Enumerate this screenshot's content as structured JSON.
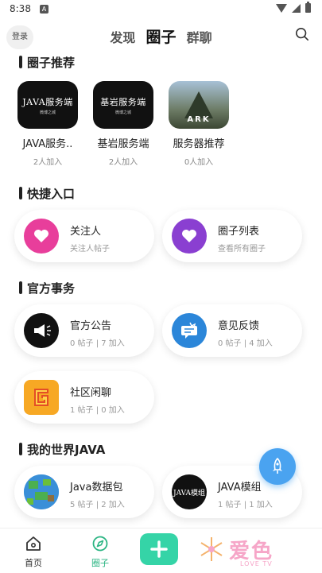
{
  "status": {
    "time": "8:38",
    "notif_letter": "A"
  },
  "header": {
    "login": "登录",
    "tabs": [
      "发现",
      "圈子",
      "群聊"
    ]
  },
  "recommend": {
    "title": "圈子推荐",
    "items": [
      {
        "thumb_text": "JAVA服务端",
        "thumb_sub": "微博之城",
        "name": "JAVA服务..",
        "count": "2人加入"
      },
      {
        "thumb_text": "基岩服务端",
        "thumb_sub": "微博之城",
        "name": "基岩服务端",
        "count": "2人加入"
      },
      {
        "thumb_text": "ARK",
        "name": "服务器推荐",
        "count": "0人加入"
      }
    ]
  },
  "quick": {
    "title": "快捷入口",
    "items": [
      {
        "title": "关注人",
        "sub": "关注人帖子",
        "color": "#e83e9b"
      },
      {
        "title": "圈子列表",
        "sub": "查看所有圈子",
        "color": "#8a3fd1"
      }
    ]
  },
  "official": {
    "title": "官方事务",
    "items": [
      {
        "title": "官方公告",
        "sub": "0 帖子 | 7 加入"
      },
      {
        "title": "意见反馈",
        "sub": "0 帖子 | 4 加入"
      },
      {
        "title": "社区闲聊",
        "sub": "1 帖子 | 0 加入"
      }
    ]
  },
  "mc_java": {
    "title": "我的世界JAVA",
    "items": [
      {
        "title": "Java数据包",
        "sub": "5 帖子 | 2 加入"
      },
      {
        "title": "JAVA模组",
        "sub": "1 帖子 | 1 加入",
        "thumb_text": "JAVA模组"
      }
    ]
  },
  "nav": {
    "home": "首页",
    "circle": "圈子",
    "watermark": "爱色",
    "watermark_sub": "LOVE TV"
  },
  "colors": {
    "accent": "#2bb583",
    "add_button": "#35d4a7",
    "fab": "#4aa3f0"
  }
}
